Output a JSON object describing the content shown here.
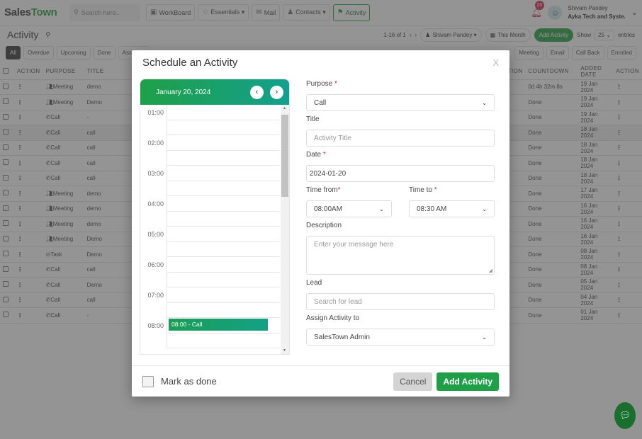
{
  "app": {
    "logo_part1": "Sales",
    "logo_part2": "Town",
    "search_placeholder": "Search here..",
    "nav": [
      {
        "label": "WorkBoard",
        "icon": "▣"
      },
      {
        "label": "Essentials ▾",
        "icon": "♢"
      },
      {
        "label": "Mail",
        "icon": "✉"
      },
      {
        "label": "Contacts ▾",
        "icon": "♟"
      },
      {
        "label": "Activity",
        "icon": "⚑"
      }
    ],
    "notifications_count": "20",
    "user_name": "Shivam Pandey",
    "user_org": "Ayka Tech and Syste."
  },
  "page": {
    "title": "Activity",
    "pagination": "1-16 of 1",
    "user_filter": "Shivam Pandey ▾",
    "period_filter": "This Month",
    "add_activity": "Add Activity",
    "show_label": "Show",
    "entries_value": "25",
    "entries_label": "entries",
    "filters": [
      "All",
      "Overdue",
      "Upcoming",
      "Done",
      "Assigned"
    ],
    "type_filters": [
      "Meeting",
      "Email",
      "Call Back",
      "Enrolled"
    ],
    "columns": [
      "ACTION",
      "PURPOSE",
      "TITLE",
      "ATION",
      "COUNTDOWN",
      "ADDED DATE",
      "ACTION"
    ],
    "rows": [
      {
        "purpose": "Meeting",
        "title": "demo",
        "countdown": "0d 4h 32m 8s",
        "date": "19 Jan 2024",
        "overdue": true
      },
      {
        "purpose": "Meeting",
        "title": "Demo",
        "countdown": "Done",
        "date": "19 Jan 2024"
      },
      {
        "purpose": "Call",
        "title": "-",
        "countdown": "Done",
        "date": "19 Jan 2024"
      },
      {
        "purpose": "Call",
        "title": "call",
        "countdown": "Done",
        "date": "18 Jan 2024",
        "highlight": true
      },
      {
        "purpose": "Call",
        "title": "call",
        "countdown": "Done",
        "date": "18 Jan 2024"
      },
      {
        "purpose": "Call",
        "title": "call",
        "countdown": "Done",
        "date": "18 Jan 2024"
      },
      {
        "purpose": "Call",
        "title": "call",
        "countdown": "Done",
        "date": "18 Jan 2024"
      },
      {
        "purpose": "Meeting",
        "title": "demo",
        "countdown": "Done",
        "date": "17 Jan 2024"
      },
      {
        "purpose": "Meeting",
        "title": "demo",
        "countdown": "Done",
        "date": "16 Jan 2024"
      },
      {
        "purpose": "Meeting",
        "title": "demo",
        "countdown": "Done",
        "date": "16 Jan 2024"
      },
      {
        "purpose": "Meeting",
        "title": "Demo",
        "countdown": "Done",
        "date": "16 Jan 2024"
      },
      {
        "purpose": "Task",
        "title": "Demo",
        "countdown": "Done",
        "date": "08 Jan 2024"
      },
      {
        "purpose": "Call",
        "title": "call",
        "countdown": "Done",
        "date": "08 Jan 2024"
      },
      {
        "purpose": "Call",
        "title": "Demo",
        "countdown": "Done",
        "date": "05 Jan 2024"
      },
      {
        "purpose": "Call",
        "title": "call",
        "countdown": "Done",
        "date": "04 Jan 2024"
      },
      {
        "purpose": "Call",
        "title": "-",
        "countdown": "Done",
        "date": "01 Jan 2024"
      }
    ]
  },
  "modal": {
    "title": "Schedule an Activity",
    "close": "X",
    "calendar": {
      "date": "January 20, 2024",
      "prev": "‹",
      "next": "›",
      "hours": [
        "01:00",
        "02:00",
        "03:00",
        "04:00",
        "05:00",
        "06:00",
        "07:00",
        "08:00"
      ],
      "event_label": "08:00 - Call",
      "event_hour": "08:00"
    },
    "form": {
      "purpose_label": "Purpose",
      "purpose_value": "Call",
      "title_label": "Title",
      "title_placeholder": "Activity Title",
      "date_label": "Date",
      "date_value": "2024-01-20",
      "time_from_label": "Time from",
      "time_from_value": "08:00AM",
      "time_to_label": "Time to",
      "time_to_value": "08:30 AM",
      "description_label": "Description",
      "description_placeholder": "Enter your message here",
      "lead_label": "Lead",
      "lead_placeholder": "Search for lead",
      "assign_label": "Assign Activity to",
      "assign_value": "SalesTown Admin",
      "required_mark": "*"
    },
    "footer": {
      "mark_done": "Mark as done",
      "cancel": "Cancel",
      "add": "Add Activity"
    }
  },
  "colors": {
    "brand_green": "#1fa048",
    "teal": "#13a08e",
    "alert_red": "#d9254a"
  }
}
